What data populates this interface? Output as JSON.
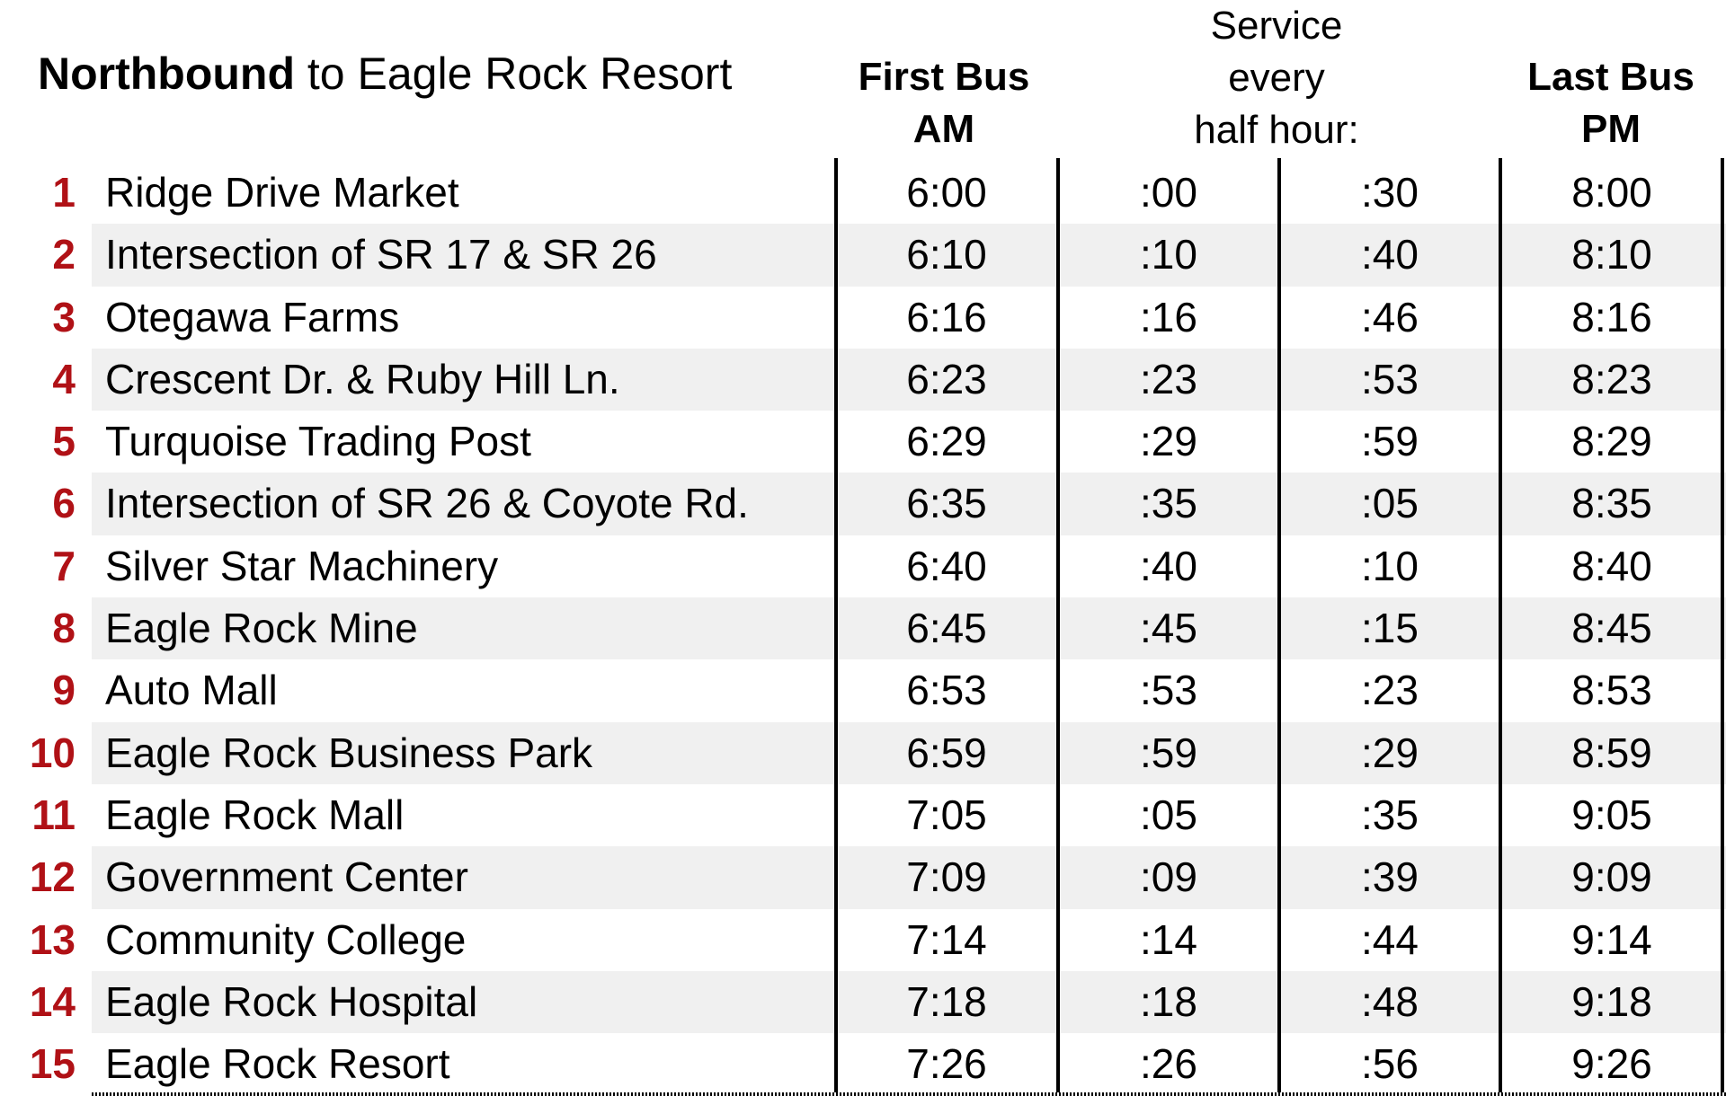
{
  "title": {
    "bold": "Northbound",
    "rest": " to Eagle Rock Resort"
  },
  "headers": {
    "first_bus": [
      "First Bus",
      "AM"
    ],
    "service": [
      "Service",
      "every",
      "half hour:"
    ],
    "last_bus": [
      "Last Bus",
      "PM"
    ]
  },
  "colors": {
    "stop_number": "#b01116",
    "alt_row": "#f0f0f0",
    "rule": "#000000"
  },
  "rows": [
    {
      "num": "1",
      "stop": "Ridge Drive Market",
      "first": "6:00",
      "s1": ":00",
      "s2": ":30",
      "last": "8:00"
    },
    {
      "num": "2",
      "stop": "Intersection of SR 17 & SR 26",
      "first": "6:10",
      "s1": ":10",
      "s2": ":40",
      "last": "8:10"
    },
    {
      "num": "3",
      "stop": "Otegawa Farms",
      "first": "6:16",
      "s1": ":16",
      "s2": ":46",
      "last": "8:16"
    },
    {
      "num": "4",
      "stop": "Crescent Dr. & Ruby Hill Ln.",
      "first": "6:23",
      "s1": ":23",
      "s2": ":53",
      "last": "8:23"
    },
    {
      "num": "5",
      "stop": "Turquoise Trading Post",
      "first": "6:29",
      "s1": ":29",
      "s2": ":59",
      "last": "8:29"
    },
    {
      "num": "6",
      "stop": "Intersection of SR 26 & Coyote Rd.",
      "first": "6:35",
      "s1": ":35",
      "s2": ":05",
      "last": "8:35"
    },
    {
      "num": "7",
      "stop": "Silver Star Machinery",
      "first": "6:40",
      "s1": ":40",
      "s2": ":10",
      "last": "8:40"
    },
    {
      "num": "8",
      "stop": "Eagle Rock Mine",
      "first": "6:45",
      "s1": ":45",
      "s2": ":15",
      "last": "8:45"
    },
    {
      "num": "9",
      "stop": "Auto Mall",
      "first": "6:53",
      "s1": ":53",
      "s2": ":23",
      "last": "8:53"
    },
    {
      "num": "10",
      "stop": "Eagle Rock Business Park",
      "first": "6:59",
      "s1": ":59",
      "s2": ":29",
      "last": "8:59"
    },
    {
      "num": "11",
      "stop": "Eagle Rock Mall",
      "first": "7:05",
      "s1": ":05",
      "s2": ":35",
      "last": "9:05"
    },
    {
      "num": "12",
      "stop": "Government Center",
      "first": "7:09",
      "s1": ":09",
      "s2": ":39",
      "last": "9:09"
    },
    {
      "num": "13",
      "stop": "Community College",
      "first": "7:14",
      "s1": ":14",
      "s2": ":44",
      "last": "9:14"
    },
    {
      "num": "14",
      "stop": "Eagle Rock Hospital",
      "first": "7:18",
      "s1": ":18",
      "s2": ":48",
      "last": "9:18"
    },
    {
      "num": "15",
      "stop": "Eagle Rock Resort",
      "first": "7:26",
      "s1": ":26",
      "s2": ":56",
      "last": "9:26"
    }
  ]
}
